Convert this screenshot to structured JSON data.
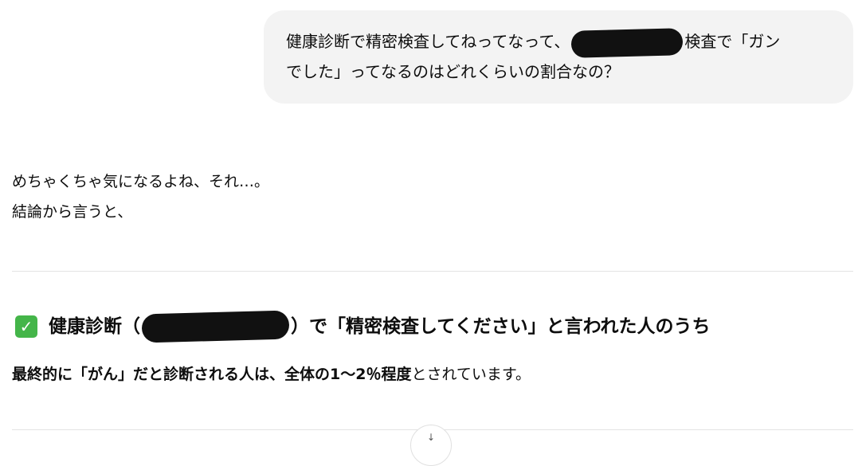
{
  "user_message": {
    "line1_before_redaction": "健康診断で精密検査してねってなって、",
    "line1_after_redaction": "検査で「ガン",
    "line2": "でした」ってなるのはどれくらいの割合なの？"
  },
  "assistant": {
    "para1": "めちゃくちゃ気になるよね、それ…。",
    "para2": "結論から言うと、",
    "heading_before_redaction": "健康診断（",
    "heading_after_redaction": "）で「精密検査してください」と言われた人のうち",
    "summary_bold": "最終的に「がん」だと診断される人は、全体の1〜2％程度",
    "summary_rest": "とされています。"
  },
  "icons": {
    "heading_icon": "check-mark-button-icon",
    "scroll_button_icon": "arrow-down-icon"
  },
  "colors": {
    "user_bubble_bg": "#f3f3f3",
    "check_icon_bg": "#44b549",
    "redaction": "#111111"
  }
}
